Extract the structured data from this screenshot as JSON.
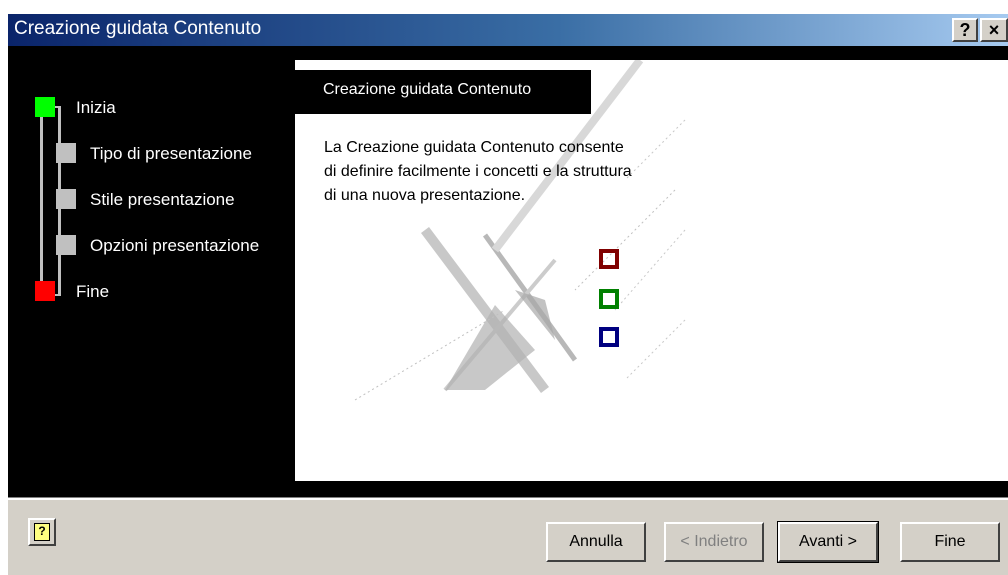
{
  "window": {
    "title": "Creazione guidata Contenuto",
    "help_button": "?",
    "close_button": "×"
  },
  "steps": [
    {
      "label": "Inizia",
      "color": "#00ff00"
    },
    {
      "label": "Tipo di presentazione",
      "color": "#c0c0c0"
    },
    {
      "label": "Stile presentazione",
      "color": "#c0c0c0"
    },
    {
      "label": "Opzioni presentazione",
      "color": "#c0c0c0"
    },
    {
      "label": "Fine",
      "color": "#ff0000"
    }
  ],
  "content": {
    "header": "Creazione guidata Contenuto",
    "description": "La Creazione guidata Contenuto consente di definire facilmente i concetti e la struttura di una nuova presentazione.",
    "squares": [
      "#800000",
      "#008000",
      "#000080"
    ]
  },
  "buttons": {
    "help_icon": "?",
    "cancel": "Annulla",
    "back": "< Indietro",
    "next": "Avanti >",
    "finish": "Fine"
  }
}
